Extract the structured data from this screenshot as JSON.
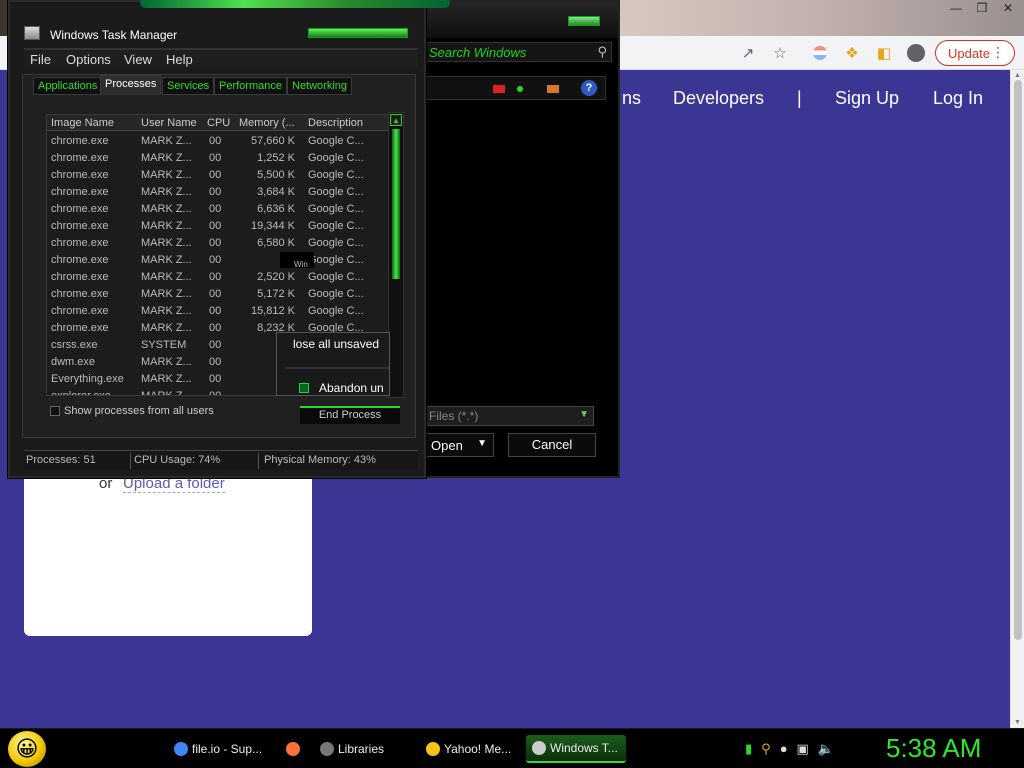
{
  "browser": {
    "update_label": "Update",
    "nav": {
      "partial": "ns",
      "developers": "Developers",
      "separator": "|",
      "sign_up": "Sign Up",
      "log_in": "Log In"
    },
    "upload": {
      "or": "or",
      "link": "Upload a folder"
    }
  },
  "open_dialog": {
    "search_placeholder": "Search Windows",
    "file_type": "Files (*.*)",
    "open_label": "Open",
    "cancel_label": "Cancel",
    "help": "?"
  },
  "task_manager": {
    "title": "Windows Task Manager",
    "menu": [
      "File",
      "Options",
      "View",
      "Help"
    ],
    "tabs": [
      "Applications",
      "Processes",
      "Services",
      "Performance",
      "Networking"
    ],
    "active_tab": "Processes",
    "columns": [
      "Image Name",
      "User Name",
      "CPU",
      "Memory (...",
      "Description"
    ],
    "rows": [
      {
        "name": "chrome.exe",
        "user": "MARK Z...",
        "cpu": "00",
        "mem": "57,660 K",
        "desc": "Google C..."
      },
      {
        "name": "chrome.exe",
        "user": "MARK Z...",
        "cpu": "00",
        "mem": "1,252 K",
        "desc": "Google C..."
      },
      {
        "name": "chrome.exe",
        "user": "MARK Z...",
        "cpu": "00",
        "mem": "5,500 K",
        "desc": "Google C..."
      },
      {
        "name": "chrome.exe",
        "user": "MARK Z...",
        "cpu": "00",
        "mem": "3,684 K",
        "desc": "Google C..."
      },
      {
        "name": "chrome.exe",
        "user": "MARK Z...",
        "cpu": "00",
        "mem": "6,636 K",
        "desc": "Google C..."
      },
      {
        "name": "chrome.exe",
        "user": "MARK Z...",
        "cpu": "00",
        "mem": "19,344 K",
        "desc": "Google C..."
      },
      {
        "name": "chrome.exe",
        "user": "MARK Z...",
        "cpu": "00",
        "mem": "6,580 K",
        "desc": "Google C..."
      },
      {
        "name": "chrome.exe",
        "user": "MARK Z...",
        "cpu": "00",
        "mem": "30",
        "desc": "Google C..."
      },
      {
        "name": "chrome.exe",
        "user": "MARK Z...",
        "cpu": "00",
        "mem": "2,520 K",
        "desc": "Google C..."
      },
      {
        "name": "chrome.exe",
        "user": "MARK Z...",
        "cpu": "00",
        "mem": "5,172 K",
        "desc": "Google C..."
      },
      {
        "name": "chrome.exe",
        "user": "MARK Z...",
        "cpu": "00",
        "mem": "15,812 K",
        "desc": "Google C..."
      },
      {
        "name": "chrome.exe",
        "user": "MARK Z...",
        "cpu": "00",
        "mem": "8,232 K",
        "desc": "Google C..."
      },
      {
        "name": "csrss.exe",
        "user": "SYSTEM",
        "cpu": "00",
        "mem": "",
        "desc": ""
      },
      {
        "name": "dwm.exe",
        "user": "MARK Z...",
        "cpu": "00",
        "mem": "1",
        "desc": ""
      },
      {
        "name": "Everything.exe",
        "user": "MARK Z...",
        "cpu": "00",
        "mem": "6",
        "desc": ""
      },
      {
        "name": "explorer.exe",
        "user": "MARK Z...",
        "cpu": "00",
        "mem": "14",
        "desc": ""
      }
    ],
    "show_all_label": "Show processes from all users",
    "end_process_label": "End Process",
    "status": {
      "processes": "Processes: 51",
      "cpu": "CPU Usage: 74%",
      "memory": "Physical Memory: 43%"
    },
    "confirm": {
      "message": "lose all unsaved",
      "option": "Abandon un",
      "tooltip_fragment": "Win"
    }
  },
  "taskbar": {
    "tasks": [
      {
        "label": "file.io - Sup...",
        "icon_color": "#4285f4"
      },
      {
        "label": "",
        "icon_color": "#ff7139"
      },
      {
        "label": "Libraries",
        "icon_color": "#777777"
      },
      {
        "label": "Yahoo! Me...",
        "icon_color": "#f5c518"
      },
      {
        "label": "Windows T...",
        "icon_color": "#cccccc"
      }
    ],
    "clock": "5:38 AM"
  }
}
